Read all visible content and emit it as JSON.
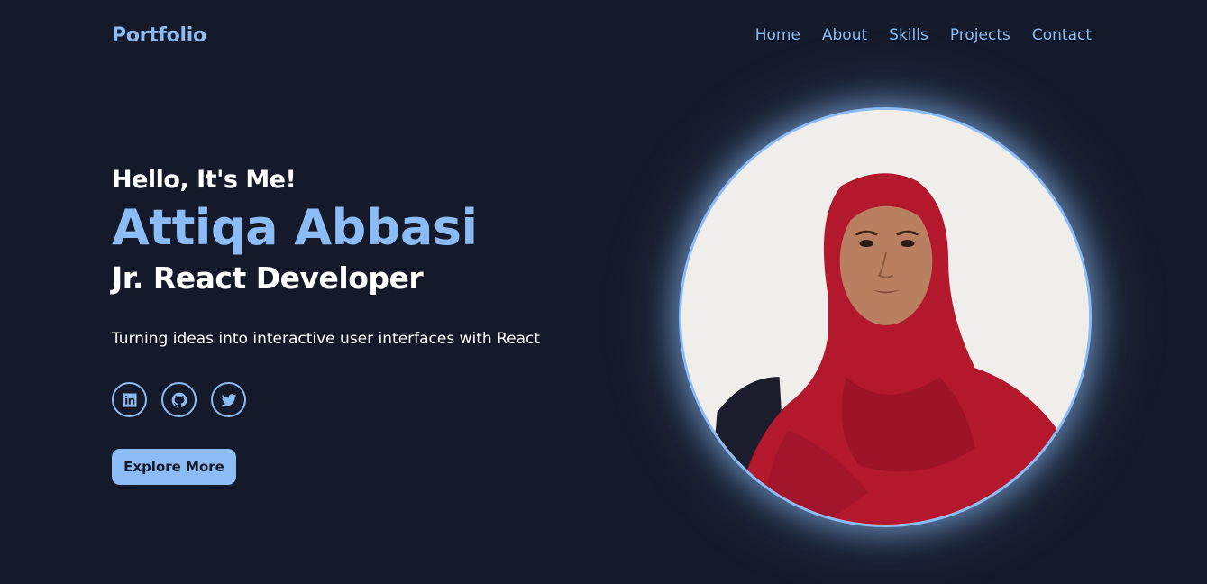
{
  "navbar": {
    "brand": "Portfolio",
    "links": [
      "Home",
      "About",
      "Skills",
      "Projects",
      "Contact"
    ]
  },
  "hero": {
    "greeting": "Hello, It's Me!",
    "name": "Attiqa Abbasi",
    "role": "Jr. React Developer",
    "tagline": "Turning ideas into interactive user interfaces with React",
    "button_label": "Explore More",
    "socials": [
      {
        "icon": "linkedin-icon"
      },
      {
        "icon": "github-icon"
      },
      {
        "icon": "twitter-icon"
      }
    ]
  },
  "colors": {
    "background": "#141a29",
    "accent": "#8cbcf6",
    "text": "#ffffff"
  }
}
